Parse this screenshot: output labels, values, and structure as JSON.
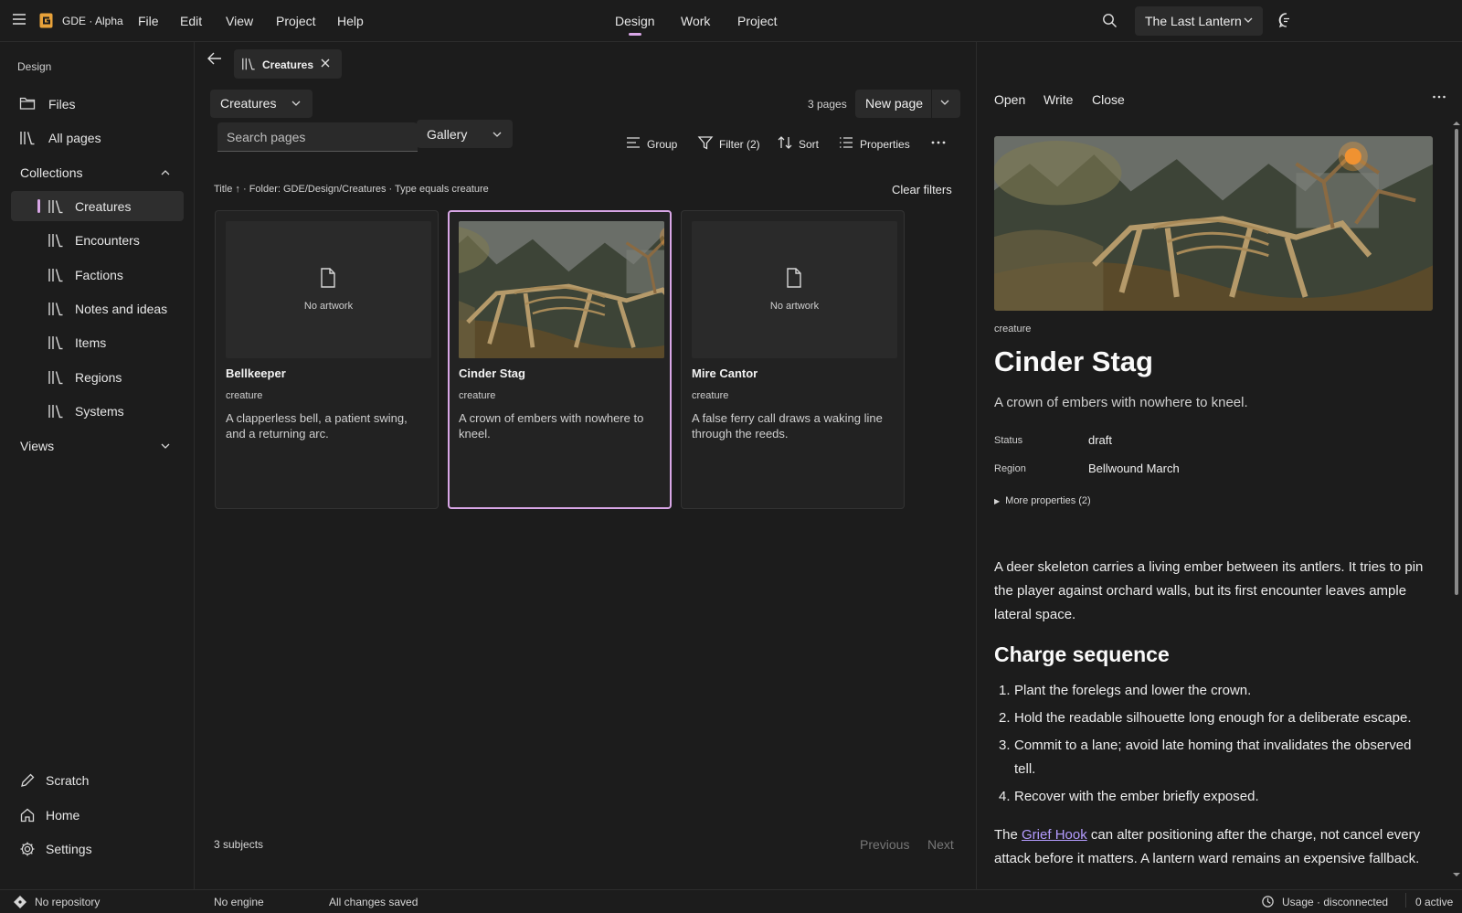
{
  "app": {
    "title": "GDE · Alpha"
  },
  "menu": [
    "File",
    "Edit",
    "View",
    "Project",
    "Help"
  ],
  "modes": [
    "Design",
    "Work",
    "Project"
  ],
  "project_select": "The Last Lantern",
  "sidebar": {
    "heading": "Design",
    "top_items": [
      {
        "label": "Files",
        "icon": "folder-icon"
      },
      {
        "label": "All pages",
        "icon": "library-icon"
      }
    ],
    "collections_label": "Collections",
    "collections": [
      "Creatures",
      "Encounters",
      "Factions",
      "Notes and ideas",
      "Items",
      "Regions",
      "Systems"
    ],
    "views_label": "Views",
    "bottom_items": [
      {
        "label": "Scratch",
        "icon": "pencil-icon"
      },
      {
        "label": "Home",
        "icon": "home-icon"
      },
      {
        "label": "Settings",
        "icon": "gear-icon"
      }
    ]
  },
  "tab": {
    "label": "Creatures"
  },
  "toolbar": {
    "collection": "Creatures",
    "search_placeholder": "Search pages",
    "view": "Gallery",
    "pages_count": "3 pages",
    "new_page": "New page",
    "group": "Group",
    "filter": "Filter (2)",
    "sort": "Sort",
    "properties": "Properties"
  },
  "filter_summary": "Title ↑ · Folder: GDE/Design/Creatures · Type equals creature",
  "clear_filters": "Clear filters",
  "cards": [
    {
      "title": "Bellkeeper",
      "type": "creature",
      "desc": "A clapperless bell, a patient swing, and a returning arc.",
      "no_art": "No artwork"
    },
    {
      "title": "Cinder Stag",
      "type": "creature",
      "desc": "A crown of embers with nowhere to kneel."
    },
    {
      "title": "Mire Cantor",
      "type": "creature",
      "desc": "A false ferry call draws a waking line through the reeds.",
      "no_art": "No artwork"
    }
  ],
  "footer": {
    "subjects": "3 subjects",
    "previous": "Previous",
    "next": "Next"
  },
  "detail": {
    "actions": [
      "Open",
      "Write",
      "Close"
    ],
    "type": "creature",
    "title": "Cinder Stag",
    "tagline": "A crown of embers with nowhere to kneel.",
    "props": [
      {
        "key": "Status",
        "value": "draft"
      },
      {
        "key": "Region",
        "value": "Bellwound March"
      }
    ],
    "more_props": "More properties (2)",
    "body": "A deer skeleton carries a living ember between its antlers. It tries to pin the player against orchard walls, but its first encounter leaves ample lateral space.",
    "heading": "Charge sequence",
    "steps": [
      "Plant the forelegs and lower the crown.",
      "Hold the readable silhouette long enough for a deliberate escape.",
      "Commit to a lane; avoid late homing that invalidates the observed tell.",
      "Recover with the ember briefly exposed."
    ],
    "para2_pre": "The ",
    "para2_link": "Grief Hook",
    "para2_post": " can alter positioning after the charge, not cancel every attack before it matters. A lantern ward remains an expensive fallback."
  },
  "status": {
    "repo": "No repository",
    "engine": "No engine",
    "saved": "All changes saved",
    "usage": "Usage · disconnected",
    "active": "0 active"
  },
  "colors": {
    "accent": "#d8a6e6",
    "logo": "#e8a23a",
    "link": "#b49cff"
  }
}
